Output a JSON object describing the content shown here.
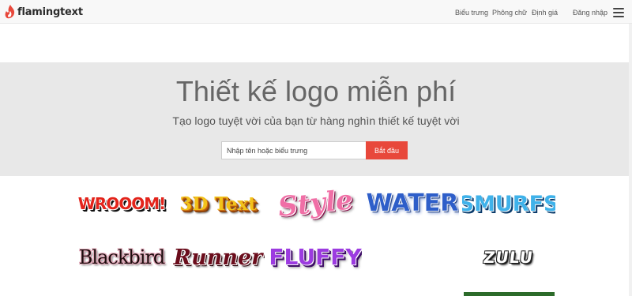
{
  "brand": {
    "name": "flamingtext",
    "accent": "#e8483b"
  },
  "nav": {
    "items": [
      {
        "label": "Biểu trưng"
      },
      {
        "label": "Phông chữ"
      },
      {
        "label": "Định giá"
      },
      {
        "label": "Đăng nhập"
      }
    ],
    "menu_icon": "hamburger-icon"
  },
  "hero": {
    "title": "Thiết kế logo miễn phí",
    "subtitle": "Tạo logo tuyệt vời của bạn từ hàng nghìn thiết kế tuyệt vời",
    "search": {
      "placeholder": "Nhập tên hoặc biểu trưng",
      "value": ""
    },
    "start_label": "Bắt đầu",
    "background": "#e8e8e8"
  },
  "logos": [
    {
      "name": "WROOOM!"
    },
    {
      "name": "3D Text"
    },
    {
      "name": "Style"
    },
    {
      "name": "WATER"
    },
    {
      "name": "SMURFS"
    },
    {
      "name": "Blackbird"
    },
    {
      "name": "Runner"
    },
    {
      "name": "FLUFFY"
    },
    {
      "name": "ZULU"
    }
  ]
}
